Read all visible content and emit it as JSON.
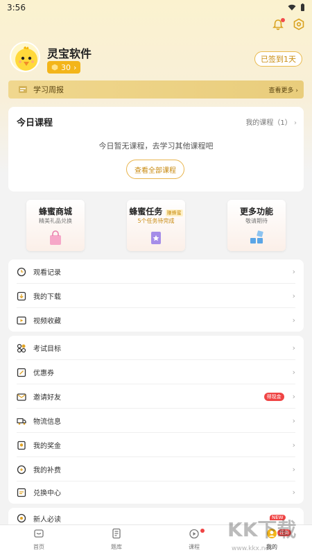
{
  "status": {
    "time": "3:56"
  },
  "profile": {
    "name": "灵宝软件",
    "points": "30",
    "checkin": "已签到1天"
  },
  "weekly": {
    "label": "学习周报",
    "more": "查看更多"
  },
  "course": {
    "title": "今日课程",
    "my_courses": "我的课程（1）",
    "empty": "今日暂无课程，去学习其他课程吧",
    "button": "查看全部课程"
  },
  "tiles": [
    {
      "title": "蜂蜜商城",
      "subtitle": "精美礼品兑换",
      "icon": "shopping-bag-icon"
    },
    {
      "title": "蜂蜜任务",
      "tag": "赚蜂蜜",
      "subtitle": "5个任务待完成",
      "icon": "task-card-icon"
    },
    {
      "title": "更多功能",
      "subtitle": "敬请期待",
      "icon": "blocks-icon"
    }
  ],
  "group1": [
    {
      "label": "观看记录",
      "icon": "history-icon"
    },
    {
      "label": "我的下载",
      "icon": "download-icon"
    },
    {
      "label": "视频收藏",
      "icon": "video-favorite-icon"
    }
  ],
  "group2": [
    {
      "label": "考试目标",
      "icon": "target-icon"
    },
    {
      "label": "优惠券",
      "icon": "coupon-icon"
    },
    {
      "label": "邀请好友",
      "icon": "invite-icon",
      "badge": "得现金"
    },
    {
      "label": "物流信息",
      "icon": "truck-icon"
    },
    {
      "label": "我的奖金",
      "icon": "bonus-icon"
    },
    {
      "label": "我的补费",
      "icon": "refund-icon"
    },
    {
      "label": "兑换中心",
      "icon": "exchange-icon"
    }
  ],
  "group3": [
    {
      "label": "新人必读",
      "icon": "guide-icon"
    }
  ],
  "tabbar": {
    "items": [
      {
        "label": "首页",
        "icon": "home-icon"
      },
      {
        "label": "题库",
        "icon": "question-bank-icon"
      },
      {
        "label": "课程",
        "icon": "course-icon"
      },
      {
        "label": "我的",
        "icon": "profile-icon"
      }
    ],
    "new_badge": "NEW",
    "task_badge": "任务"
  },
  "watermark": {
    "text": "KK下载",
    "url": "www.kkx.net"
  },
  "colors": {
    "accent": "#f3b51a",
    "accent_text": "#c88a10",
    "badge_red": "#ef4444",
    "banner": "#f0d78e"
  }
}
